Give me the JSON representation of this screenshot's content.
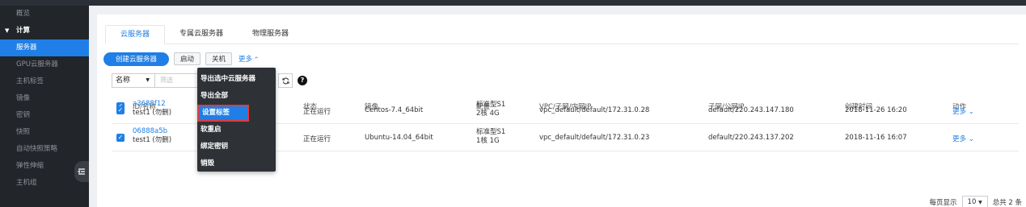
{
  "sidebar": {
    "items": [
      {
        "label": "概览",
        "kind": "item"
      },
      {
        "label": "计算",
        "kind": "group"
      },
      {
        "label": "服务器",
        "kind": "active"
      },
      {
        "label": "GPU云服务器",
        "kind": "item"
      },
      {
        "label": "主机标签",
        "kind": "item"
      },
      {
        "label": "镜像",
        "kind": "item"
      },
      {
        "label": "密钥",
        "kind": "item"
      },
      {
        "label": "快照",
        "kind": "item"
      },
      {
        "label": "自动快照策略",
        "kind": "item"
      },
      {
        "label": "弹性伸缩",
        "kind": "item"
      },
      {
        "label": "主机组",
        "kind": "item"
      }
    ]
  },
  "tabs": [
    "云服务器",
    "专属云服务器",
    "物理服务器"
  ],
  "toolbar": {
    "create_label": "创建云服务器",
    "start_label": "启动",
    "stop_label": "关机",
    "more_label": "更多"
  },
  "filter": {
    "field_label": "名称",
    "placeholder": "筛选"
  },
  "dropdown": {
    "items": [
      "导出选中云服务器",
      "导出全部",
      "设置标签",
      "软重启",
      "绑定密钥",
      "销毁"
    ],
    "highlighted_index": 2
  },
  "table": {
    "columns": [
      "ID/名称",
      "状态",
      "镜像",
      "配置",
      "VPC/子网/内网IP",
      "子网/公网IP",
      "创建时间",
      "动作"
    ],
    "rows": [
      {
        "id": "a3688f12",
        "name": "test1 (勿删)",
        "status": "正在运行",
        "image": "Centos-7.4_64bit",
        "config1": "标准型S1",
        "config2": "2核 4G",
        "vpc": "vpc_default/default/172.31.0.28",
        "public": "default/220.243.147.180",
        "created": "2018-11-26 16:20",
        "action": "更多"
      },
      {
        "id": "06888a5b",
        "name": "test1 (勿删)",
        "status": "正在运行",
        "image": "Ubuntu-14.04_64bit",
        "config1": "标准型S1",
        "config2": "1核 1G",
        "vpc": "vpc_default/default/172.31.0.23",
        "public": "default/220.243.137.202",
        "created": "2018-11-16 16:07",
        "action": "更多"
      }
    ]
  },
  "footer": {
    "per_page_label": "每页显示",
    "page_size": "10",
    "total_label": "总共 2 条"
  },
  "colors": {
    "accent": "#1f7fe6",
    "sidebar_bg": "#222529",
    "highlight_border": "#e03b3b"
  }
}
